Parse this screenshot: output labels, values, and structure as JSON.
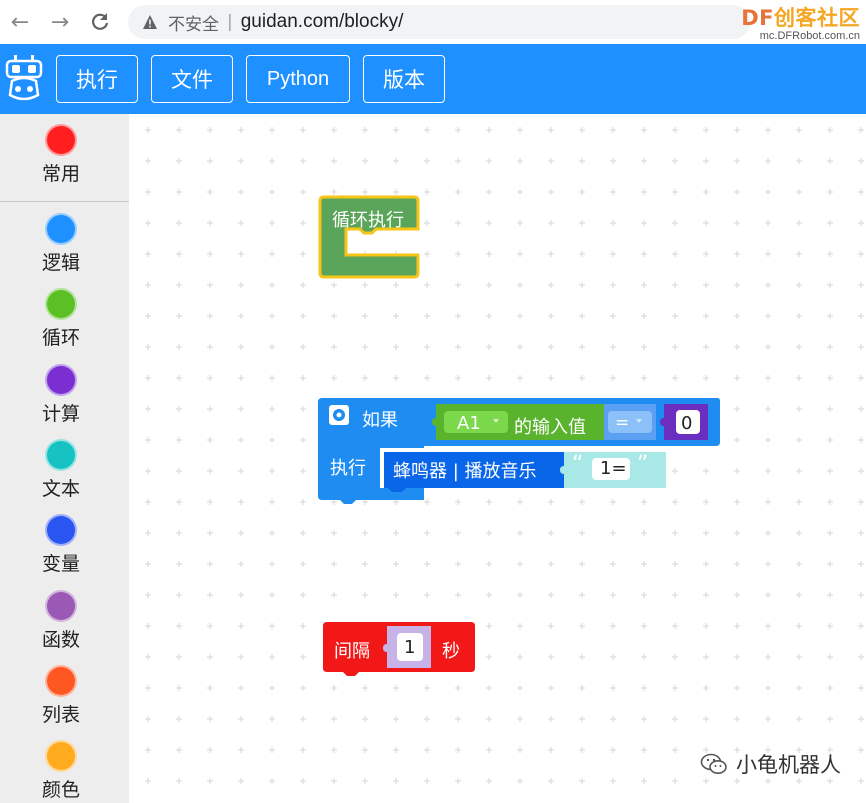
{
  "browser": {
    "insecure_label": "不安全",
    "separator": "|",
    "url": "guidan.com/blocky/",
    "brand_title_df": "DF",
    "brand_title_rest": "创客社区",
    "brand_subtitle": "mc.DFRobot.com.cn"
  },
  "menu": {
    "run": "执行",
    "file": "文件",
    "python": "Python",
    "version": "版本"
  },
  "categories": [
    {
      "label": "常用",
      "color": "#ff1f1f"
    },
    {
      "label": "逻辑",
      "color": "#1e90ff"
    },
    {
      "label": "循环",
      "color": "#5ac023"
    },
    {
      "label": "计算",
      "color": "#7b2fd3"
    },
    {
      "label": "文本",
      "color": "#17c2c2"
    },
    {
      "label": "变量",
      "color": "#2b55f0"
    },
    {
      "label": "函数",
      "color": "#9a59b5"
    },
    {
      "label": "列表",
      "color": "#ff5722"
    },
    {
      "label": "颜色",
      "color": "#ffaa1f"
    }
  ],
  "blocks": {
    "loop": {
      "label": "循环执行",
      "color": "#5ba55b",
      "highlight": "#f5c518"
    },
    "if_block": {
      "if_label": "如果",
      "do_label": "执行",
      "color": "#1e8cf0",
      "pin_value": "A1",
      "input_label": "的输入值",
      "operator": "=",
      "compare_value": "0",
      "buzzer_label": "蜂鸣器 | 播放音乐",
      "quote_open": "“",
      "music_value": "1=",
      "quote_close": "”"
    },
    "delay": {
      "label_prefix": "间隔",
      "value": "1",
      "label_suffix": "秒",
      "color": "#f21818"
    }
  },
  "watermark": {
    "text": "小龟机器人"
  }
}
